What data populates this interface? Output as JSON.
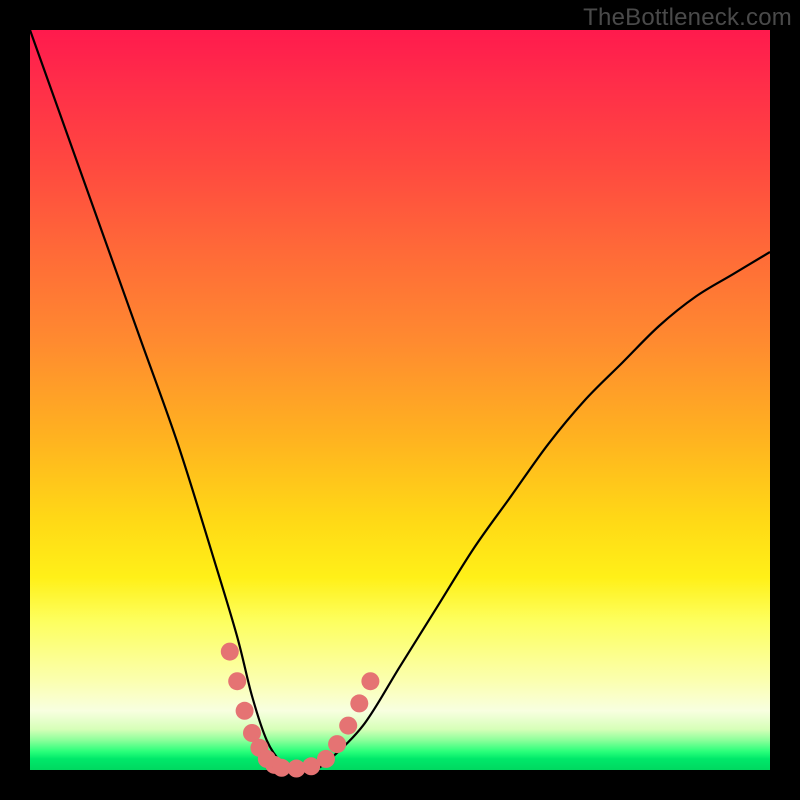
{
  "watermark": "TheBottleneck.com",
  "colors": {
    "frame": "#000000",
    "curve": "#000000",
    "marker": "#e57373",
    "gradient_top": "#ff1a4d",
    "gradient_bottom": "#00d860"
  },
  "chart_data": {
    "type": "line",
    "title": "",
    "xlabel": "",
    "ylabel": "",
    "xlim": [
      0,
      100
    ],
    "ylim": [
      0,
      100
    ],
    "grid": false,
    "legend": false,
    "series": [
      {
        "name": "bottleneck-curve",
        "x": [
          0,
          5,
          10,
          15,
          20,
          25,
          28,
          30,
          32,
          34,
          36,
          38,
          40,
          45,
          50,
          55,
          60,
          65,
          70,
          75,
          80,
          85,
          90,
          95,
          100
        ],
        "y": [
          100,
          86,
          72,
          58,
          44,
          28,
          18,
          10,
          4,
          1,
          0,
          0,
          1,
          6,
          14,
          22,
          30,
          37,
          44,
          50,
          55,
          60,
          64,
          67,
          70
        ]
      }
    ],
    "markers": [
      {
        "x": 27,
        "y": 16
      },
      {
        "x": 28,
        "y": 12
      },
      {
        "x": 29,
        "y": 8
      },
      {
        "x": 30,
        "y": 5
      },
      {
        "x": 31,
        "y": 3
      },
      {
        "x": 32,
        "y": 1.5
      },
      {
        "x": 33,
        "y": 0.7
      },
      {
        "x": 34,
        "y": 0.3
      },
      {
        "x": 36,
        "y": 0.2
      },
      {
        "x": 38,
        "y": 0.5
      },
      {
        "x": 40,
        "y": 1.5
      },
      {
        "x": 41.5,
        "y": 3.5
      },
      {
        "x": 43,
        "y": 6
      },
      {
        "x": 44.5,
        "y": 9
      },
      {
        "x": 46,
        "y": 12
      }
    ],
    "annotations": []
  }
}
